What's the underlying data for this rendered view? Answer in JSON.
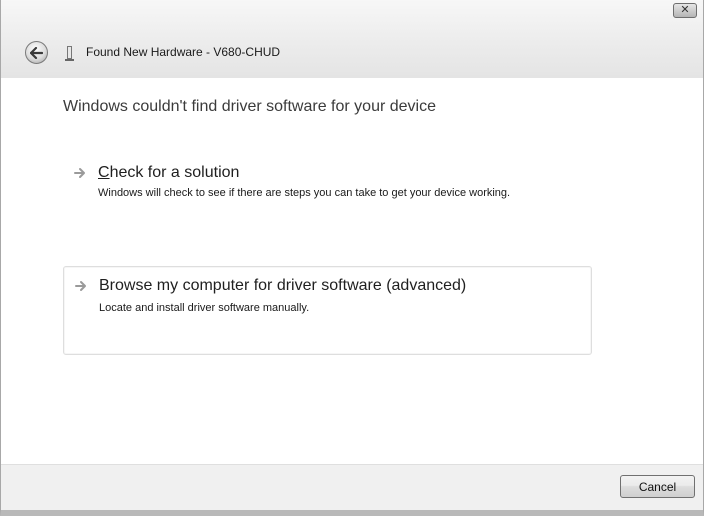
{
  "window": {
    "title": "Found New Hardware - V680-CHUD",
    "close_glyph": "✕",
    "back_icon": "back-arrow-icon",
    "device_icon": "hardware-device-icon"
  },
  "content": {
    "heading": "Windows couldn't find driver software for your device",
    "options": [
      {
        "accelerator": "C",
        "title_rest": "heck for a solution",
        "description": "Windows will check to see if there are steps you can take to get your device working.",
        "icon": "arrow-right-icon"
      },
      {
        "title": "Browse my computer for driver software (advanced)",
        "description": "Locate and install driver software manually.",
        "icon": "arrow-right-icon"
      }
    ]
  },
  "footer": {
    "cancel_label": "Cancel"
  },
  "colors": {
    "titlebar": "#ececec",
    "footer": "#f0f0f0",
    "text": "#1e1e1e",
    "heading": "#3b3b3b"
  }
}
